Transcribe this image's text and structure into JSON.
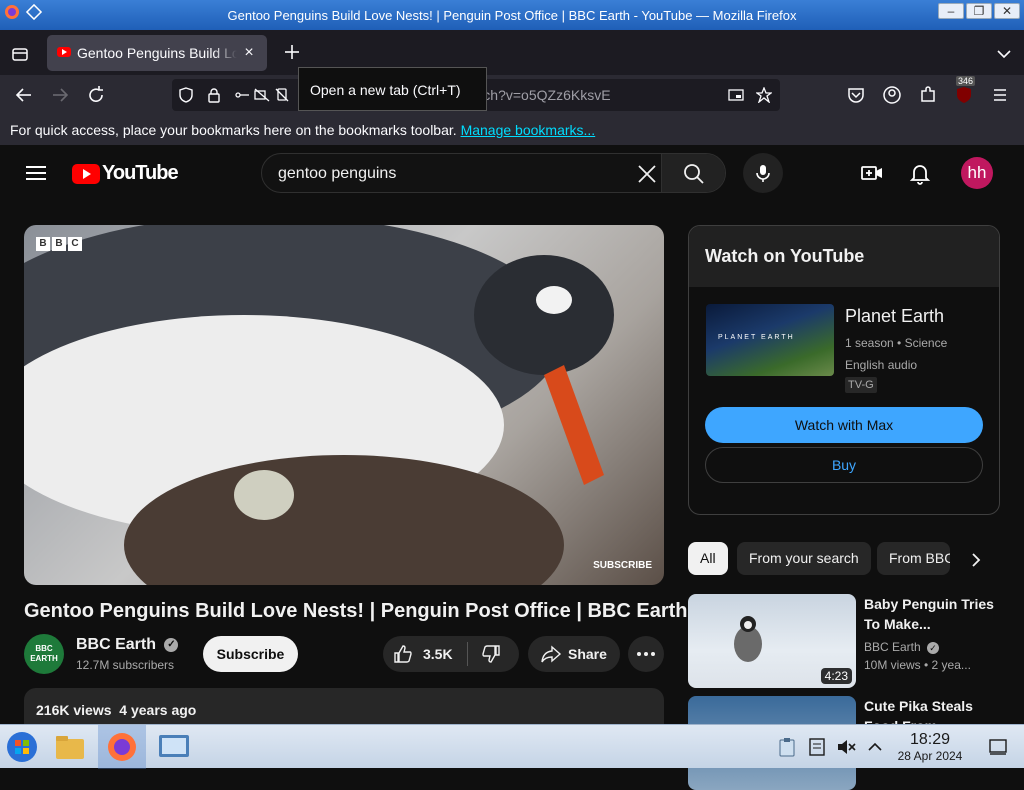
{
  "window": {
    "title": "Gentoo Penguins Build Love Nests! | Penguin Post Office | BBC Earth - YouTube — Mozilla Firefox",
    "buttons": [
      "minimize",
      "maximize",
      "close"
    ]
  },
  "browser": {
    "tab_title": "Gentoo Penguins Build Love Nests! | Penguin Post Office | BBC Earth - YouTube",
    "tooltip": "Open a new tab (Ctrl+T)",
    "url": "https://www.youtube.com/watch?v=o5QZz6KksvE",
    "extension_badge": "346",
    "bookmarks_message": "For quick access, place your bookmarks here on the bookmarks toolbar.",
    "bookmarks_link": "Manage bookmarks..."
  },
  "youtube": {
    "logo_text": "YouTube",
    "search_query": "gentoo penguins",
    "avatar_initials": "hh",
    "video": {
      "watermark": [
        "B",
        "B",
        "C"
      ],
      "subscribe_overlay": "SUBSCRIBE",
      "title": "Gentoo Penguins Build Love Nests! | Penguin Post Office | BBC Earth",
      "channel_name": "BBC Earth",
      "channel_avatar_text": "BBC EARTH",
      "subscribers": "12.7M subscribers",
      "subscribe_label": "Subscribe",
      "likes": "3.5K",
      "share_label": "Share",
      "views": "216K views",
      "age": "4 years ago"
    },
    "watch_panel": {
      "heading": "Watch on YouTube",
      "thumb_text": "PLANET EARTH",
      "title": "Planet Earth",
      "meta1": "1 season • Science",
      "meta2": "English audio",
      "rating": "TV-G",
      "primary_button": "Watch with Max",
      "secondary_button": "Buy"
    },
    "chips": [
      "All",
      "From your search",
      "From BBC Earth"
    ],
    "related": [
      {
        "title": "Baby Penguin Tries To Make...",
        "channel": "BBC Earth",
        "meta": "10M views  •  2 yea...",
        "duration": "4:23"
      },
      {
        "title": "Cute Pika Steals Food From...",
        "channel": "",
        "meta": "",
        "duration": ""
      }
    ]
  },
  "taskbar": {
    "time": "18:29",
    "date": "28 Apr 2024"
  },
  "colors": {
    "yt_background": "#0f0f0f",
    "accent_blue": "#3ea6ff",
    "youtube_red": "#ff0000",
    "avatar": "#c0185f",
    "firefox_toolbar": "#2b2a33"
  }
}
